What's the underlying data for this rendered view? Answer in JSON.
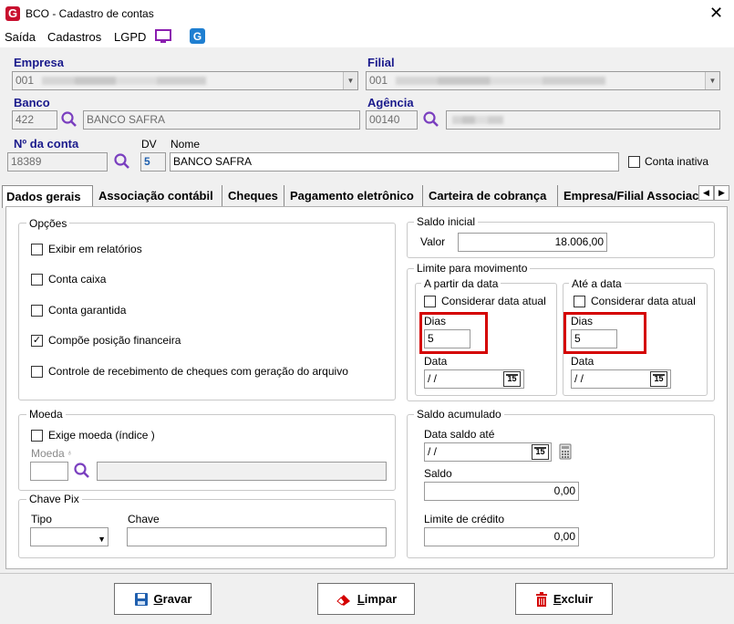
{
  "window": {
    "title": "BCO - Cadastro de contas",
    "app_icon": "G"
  },
  "menu": {
    "items": [
      "Saída",
      "Cadastros",
      "LGPD"
    ]
  },
  "header": {
    "empresa_label": "Empresa",
    "empresa_code": "001",
    "filial_label": "Filial",
    "filial_code": "001",
    "banco_label": "Banco",
    "banco_code": "422",
    "banco_name": "BANCO SAFRA",
    "agencia_label": "Agência",
    "agencia_code": "00140",
    "conta_label": "Nº da conta",
    "conta_value": "18389",
    "dv_label": "DV",
    "dv_value": "5",
    "nome_label": "Nome",
    "nome_value": "BANCO SAFRA",
    "conta_inativa_label": "Conta inativa"
  },
  "tabs": [
    "Dados gerais",
    "Associação contábil",
    "Cheques",
    "Pagamento eletrônico",
    "Carteira de cobrança",
    "Empresa/Filial Associac"
  ],
  "opcoes": {
    "title": "Opções",
    "items": [
      {
        "label": "Exibir em relatórios",
        "checked": false
      },
      {
        "label": "Conta caixa",
        "checked": false
      },
      {
        "label": "Conta garantida",
        "checked": false
      },
      {
        "label": "Compõe posição financeira",
        "checked": true,
        "mark": "✓"
      },
      {
        "label": "Controle de recebimento de cheques com geração do arquivo",
        "checked": false
      }
    ]
  },
  "moeda": {
    "title": "Moeda",
    "exige_label": "Exige moeda (índice )",
    "moeda_label": "Moeda"
  },
  "chave_pix": {
    "title": "Chave Pix",
    "tipo_label": "Tipo",
    "chave_label": "Chave"
  },
  "saldo_inicial": {
    "title": "Saldo inicial",
    "valor_label": "Valor",
    "valor": "18.006,00"
  },
  "limite": {
    "title": "Limite para movimento",
    "a_partir": {
      "title": "A partir da data",
      "considerar_label": "Considerar data atual",
      "dias_label": "Dias",
      "dias": "5",
      "data_label": "Data",
      "data": " / /"
    },
    "ate": {
      "title": "Até a data",
      "considerar_label": "Considerar data atual",
      "dias_label": "Dias",
      "dias": "5",
      "data_label": "Data",
      "data": " / /"
    },
    "cal_label": "15"
  },
  "saldo_acumulado": {
    "title": "Saldo acumulado",
    "data_label": "Data saldo até",
    "data": " / /",
    "saldo_label": "Saldo",
    "saldo": "0,00",
    "limite_label": "Limite de crédito",
    "limite": "0,00"
  },
  "buttons": {
    "gravar_first": "G",
    "gravar_rest": "ravar",
    "limpar_first": "L",
    "limpar_rest": "impar",
    "excluir_first": "E",
    "excluir_rest": "xcluir"
  },
  "colors": {
    "accent_label": "#1a1a8c",
    "highlight": "#d40000",
    "save_icon": "#1f5fae",
    "delete_icon": "#d40000"
  }
}
